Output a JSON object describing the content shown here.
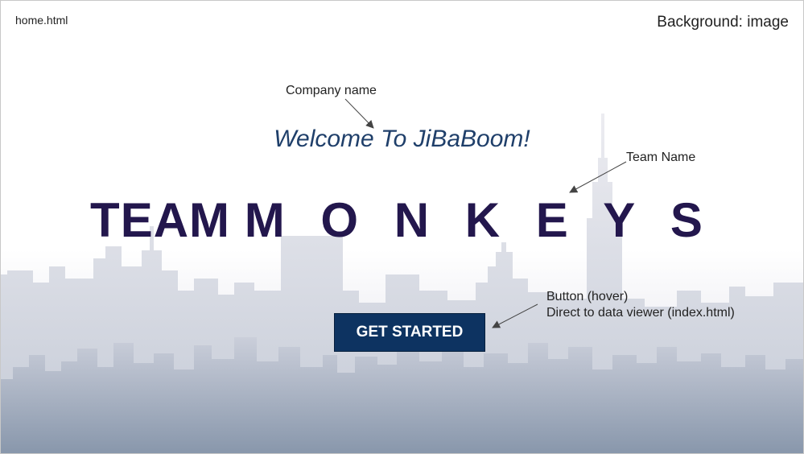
{
  "file_name": "home.html",
  "background_note": "Background: image",
  "welcome_text": "Welcome To JiBaBoom!",
  "team": {
    "word1": "TEAM",
    "word2": "M O N K E Y S"
  },
  "button": {
    "label": "GET STARTED"
  },
  "annotations": {
    "company": "Company name",
    "team": "Team Name",
    "button_line1": "Button (hover)",
    "button_line2": "Direct to data viewer (index.html)"
  },
  "colors": {
    "welcome": "#1f3f6a",
    "team_title": "#23174d",
    "button_bg": "#0d3361",
    "skyline_dark": "#7a8aa0",
    "skyline_light": "#e6e6ee"
  }
}
